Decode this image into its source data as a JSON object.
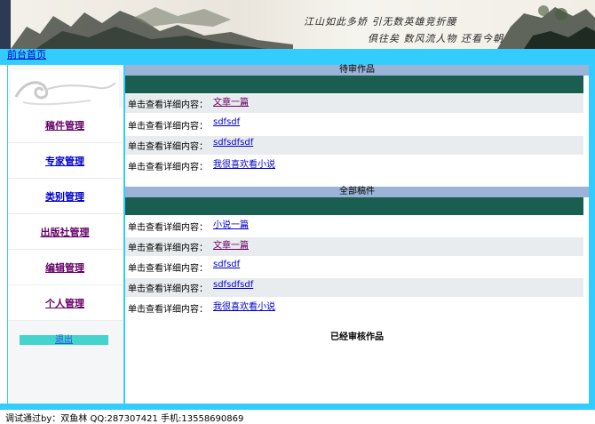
{
  "banner": {
    "poem_line1": "江山如此多娇 引无数英雄竞折腰",
    "poem_line2": "俱往矣 数风流人物 还看今朝"
  },
  "nav": {
    "home_link": "前台首页"
  },
  "sidebar": {
    "items": [
      {
        "label": "稿件管理"
      },
      {
        "label": "专家管理"
      },
      {
        "label": "类别管理"
      },
      {
        "label": "出版社管理"
      },
      {
        "label": "编辑管理"
      },
      {
        "label": "个人管理"
      }
    ],
    "exit_label": "退出"
  },
  "pending": {
    "title": "待审作品",
    "row_label": "单击查看详细内容：",
    "rows": [
      {
        "title": "文章一篇"
      },
      {
        "title": "sdfsdf"
      },
      {
        "title": "sdfsdfsdf"
      },
      {
        "title": "我很喜欢看小说"
      }
    ]
  },
  "all": {
    "title": "全部稿件",
    "row_label": "单击查看详细内容：",
    "rows": [
      {
        "title": "小说一篇"
      },
      {
        "title": "文章一篇"
      },
      {
        "title": "sdfsdf"
      },
      {
        "title": "sdfsdfsdf"
      },
      {
        "title": "我很喜欢看小说"
      }
    ]
  },
  "reviewed": {
    "title": "已经审核作品"
  },
  "footer": {
    "text": "调试通过by：双鱼林  QQ:287307421 手机:13558690869"
  },
  "colors": {
    "accent": "#33ccff",
    "section_header": "#9bb3d6",
    "green_bar": "#1a5e52",
    "exit_button": "#44d4cc",
    "visited_link": "#660066",
    "link": "#0000cc"
  }
}
